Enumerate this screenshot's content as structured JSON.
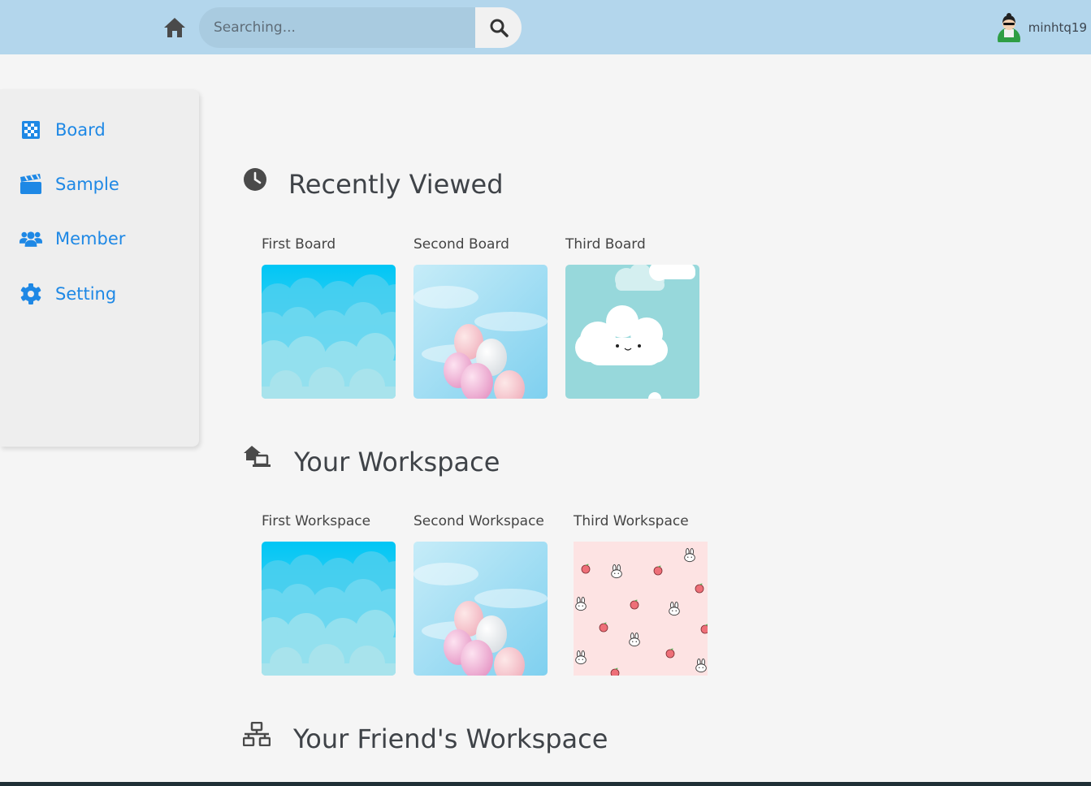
{
  "header": {
    "search_placeholder": "Searching...",
    "username": "minhtq19"
  },
  "sidebar": {
    "items": [
      {
        "label": "Board",
        "icon": "board-icon"
      },
      {
        "label": "Sample",
        "icon": "clapperboard-icon"
      },
      {
        "label": "Member",
        "icon": "users-icon"
      },
      {
        "label": "Setting",
        "icon": "gear-icon"
      }
    ]
  },
  "sections": {
    "recent": {
      "title": "Recently Viewed",
      "cards": [
        {
          "label": "First Board",
          "image": "blue-clouds"
        },
        {
          "label": "Second Board",
          "image": "pink-balloons"
        },
        {
          "label": "Third Board",
          "image": "cute-cloud"
        }
      ]
    },
    "workspace": {
      "title": "Your Workspace",
      "cards": [
        {
          "label": "First Workspace",
          "image": "blue-clouds"
        },
        {
          "label": "Second Workspace",
          "image": "pink-balloons"
        },
        {
          "label": "Third Workspace",
          "image": "bunny-peach-pattern"
        }
      ]
    },
    "friends": {
      "title": "Your Friend's Workspace"
    }
  },
  "colors": {
    "topbar": "#b3d6ec",
    "accent": "#1e88e5",
    "background": "#f5f5f5"
  }
}
